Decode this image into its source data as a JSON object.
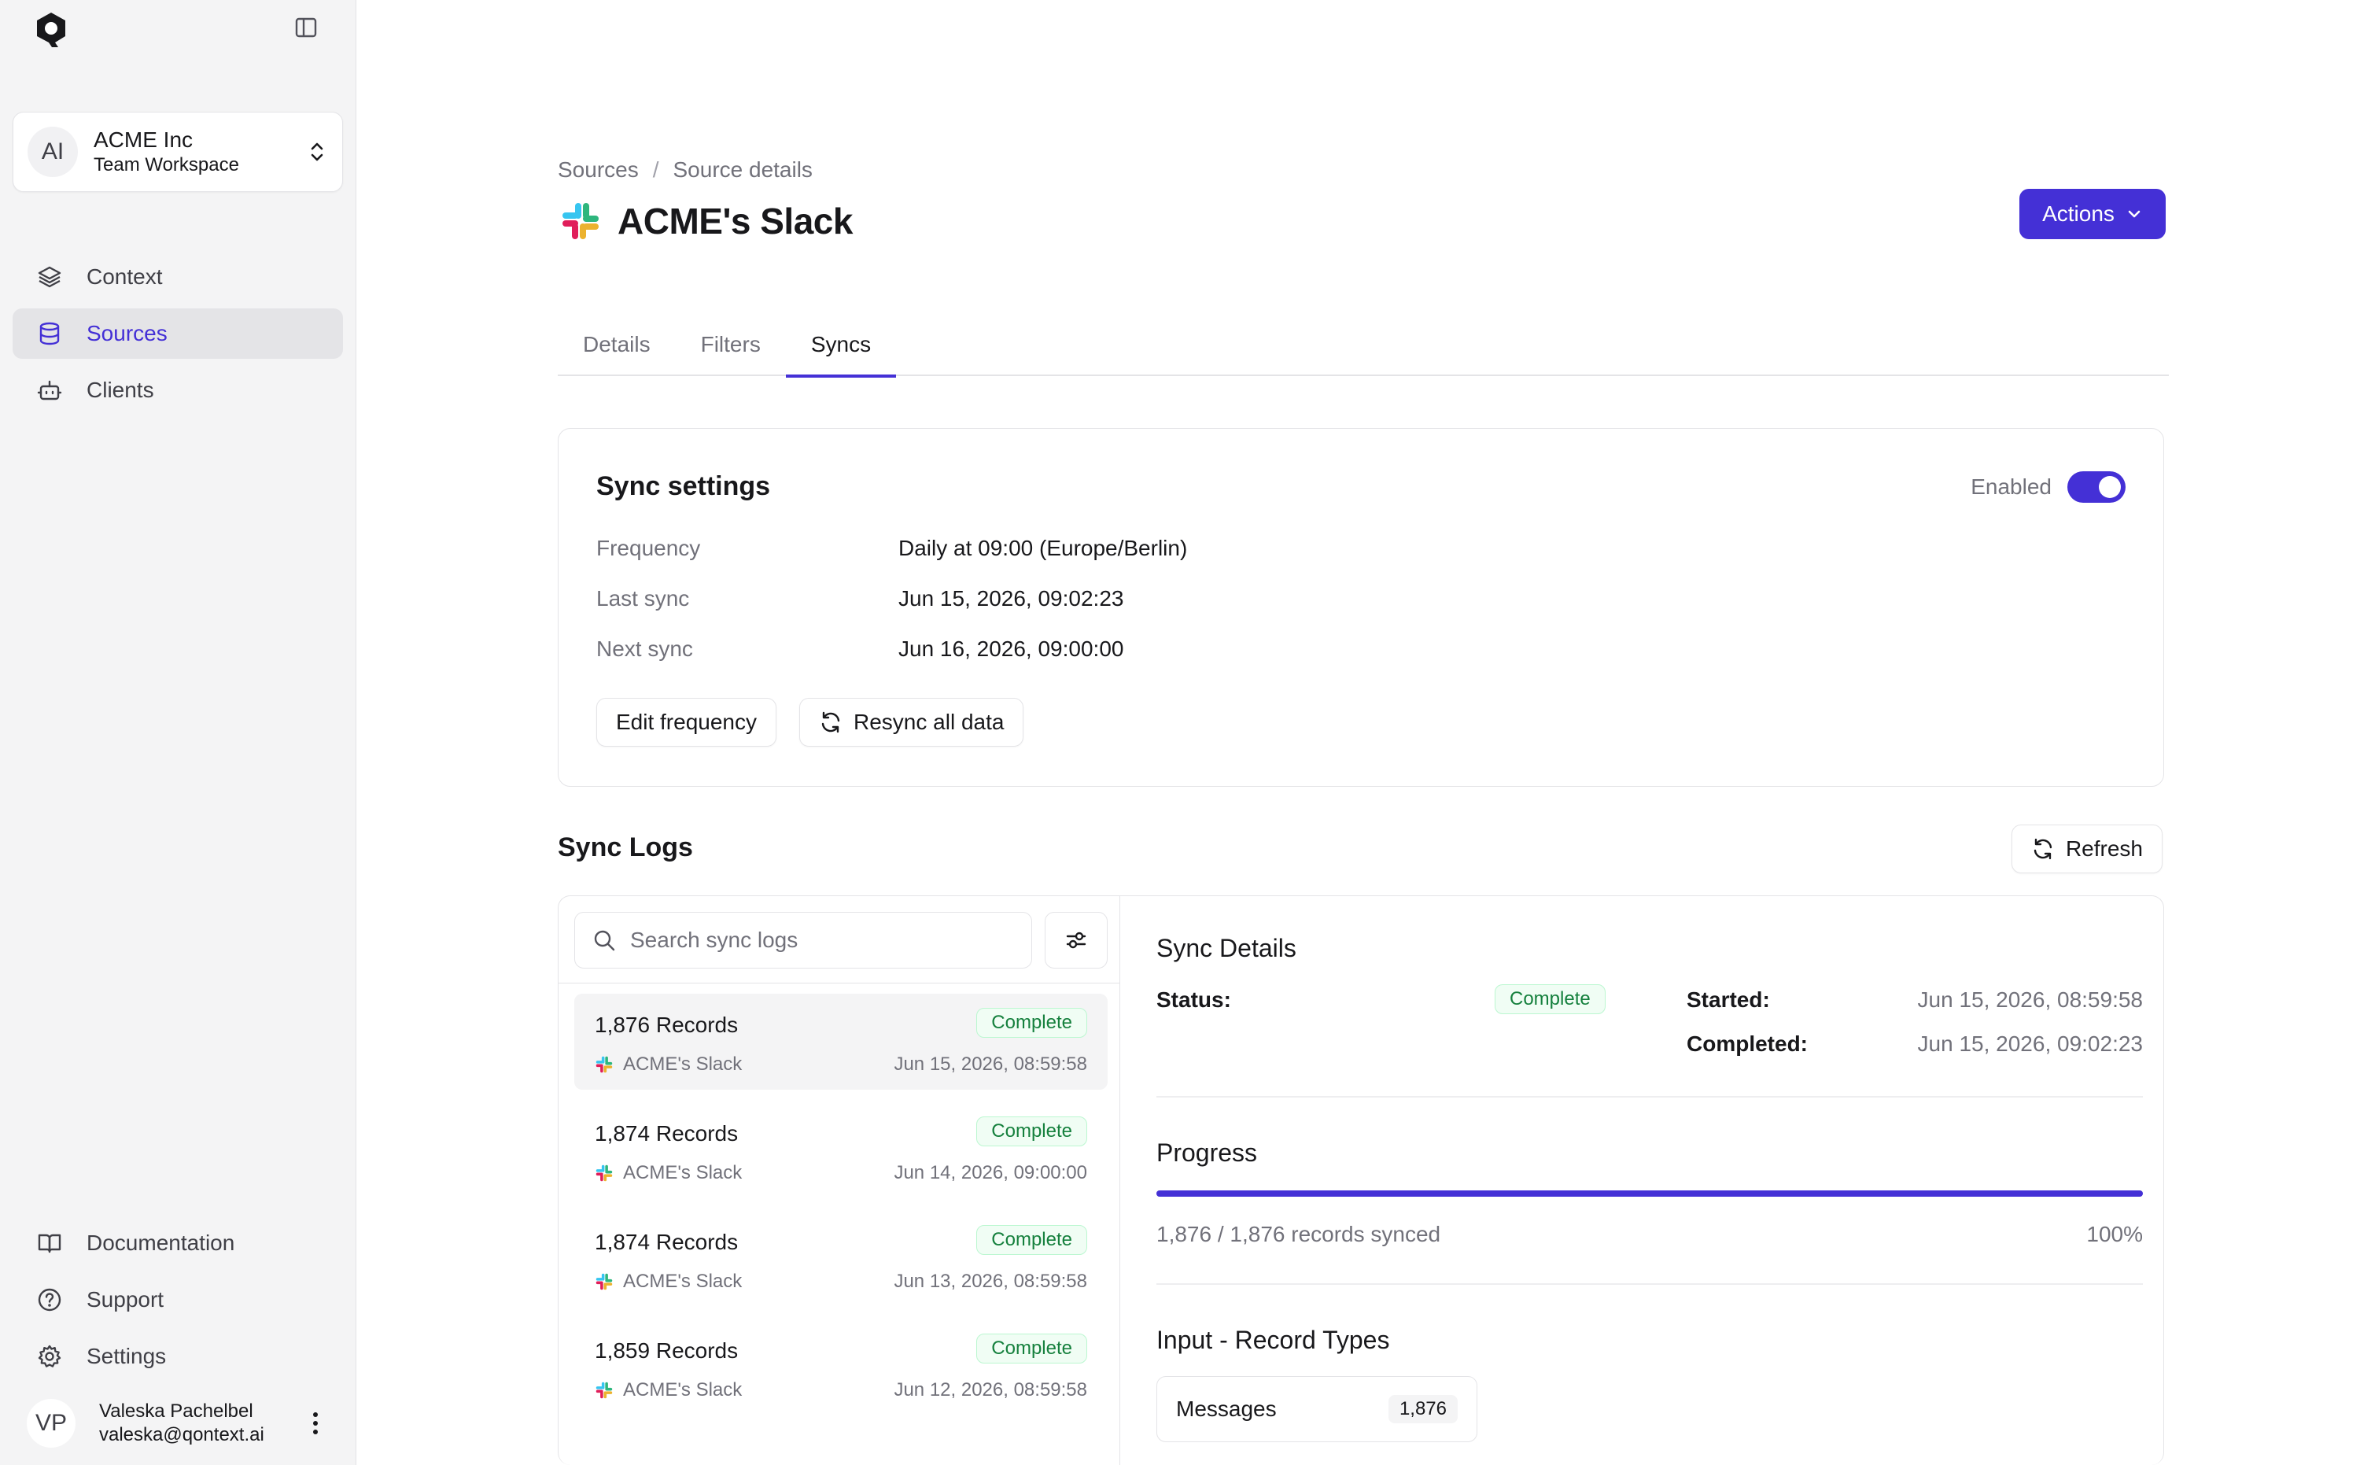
{
  "workspace": {
    "initials": "AI",
    "name": "ACME Inc",
    "subtitle": "Team Workspace"
  },
  "nav": {
    "items": [
      {
        "label": "Context",
        "icon": "layers-icon"
      },
      {
        "label": "Sources",
        "icon": "database-icon",
        "active": true
      },
      {
        "label": "Clients",
        "icon": "robot-icon"
      }
    ],
    "bottom": [
      {
        "label": "Documentation",
        "icon": "book-icon"
      },
      {
        "label": "Support",
        "icon": "help-circle-icon"
      },
      {
        "label": "Settings",
        "icon": "gear-icon"
      }
    ]
  },
  "user": {
    "initials": "VP",
    "name": "Valeska Pachelbel",
    "email": "valeska@qontext.ai"
  },
  "breadcrumb": {
    "root": "Sources",
    "separator": "/",
    "current": "Source details"
  },
  "page": {
    "title": "ACME's Slack",
    "actions_label": "Actions"
  },
  "tabs": [
    {
      "label": "Details"
    },
    {
      "label": "Filters"
    },
    {
      "label": "Syncs",
      "active": true
    }
  ],
  "sync_settings": {
    "title": "Sync settings",
    "enabled_label": "Enabled",
    "enabled": true,
    "rows": [
      {
        "key": "Frequency",
        "value": "Daily at 09:00 (Europe/Berlin)"
      },
      {
        "key": "Last sync",
        "value": "Jun 15, 2026, 09:02:23"
      },
      {
        "key": "Next sync",
        "value": "Jun 16, 2026, 09:00:00"
      }
    ],
    "edit_label": "Edit frequency",
    "resync_label": "Resync all data"
  },
  "logs": {
    "title": "Sync Logs",
    "refresh_label": "Refresh",
    "search_placeholder": "Search sync logs",
    "items": [
      {
        "records": "1,876 Records",
        "status": "Complete",
        "source": "ACME's Slack",
        "date": "Jun 15, 2026, 08:59:58",
        "selected": true
      },
      {
        "records": "1,874 Records",
        "status": "Complete",
        "source": "ACME's Slack",
        "date": "Jun 14, 2026, 09:00:00"
      },
      {
        "records": "1,874 Records",
        "status": "Complete",
        "source": "ACME's Slack",
        "date": "Jun 13, 2026, 08:59:58"
      },
      {
        "records": "1,859 Records",
        "status": "Complete",
        "source": "ACME's Slack",
        "date": "Jun 12, 2026, 08:59:58"
      }
    ]
  },
  "details": {
    "title": "Sync Details",
    "status_label": "Status:",
    "status": "Complete",
    "started_label": "Started:",
    "started": "Jun 15, 2026, 08:59:58",
    "completed_label": "Completed:",
    "completed": "Jun 15, 2026, 09:02:23",
    "progress_title": "Progress",
    "progress_text": "1,876 / 1,876 records synced",
    "progress_pct": "100%",
    "progress_fraction": 1.0,
    "record_types_title": "Input - Record Types",
    "record_types": [
      {
        "name": "Messages",
        "count": "1,876"
      }
    ]
  },
  "colors": {
    "accent": "#4430d6",
    "success_text": "#15803d",
    "success_bg": "#f0fdf4",
    "muted": "#71717a"
  }
}
